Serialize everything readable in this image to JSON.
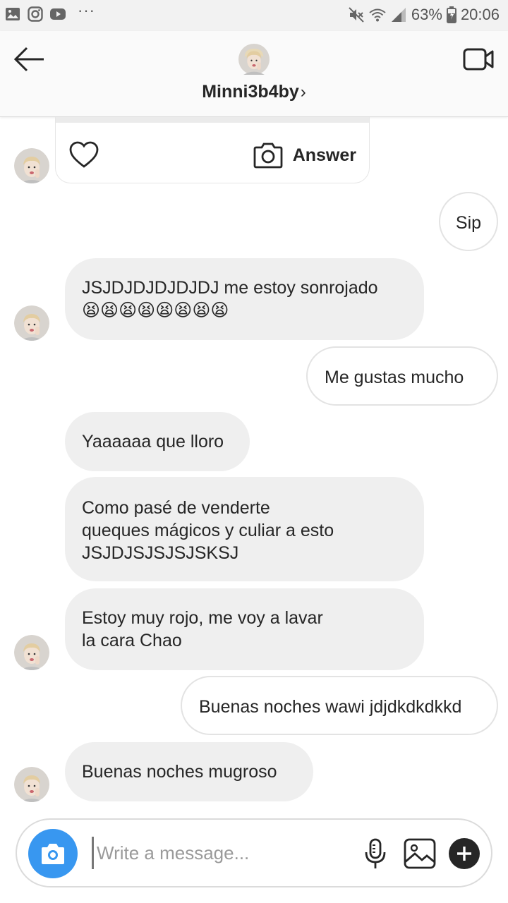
{
  "status_bar": {
    "dots": "···",
    "battery": "63%",
    "time": "20:06",
    "icons": [
      "gallery-icon",
      "instagram-icon",
      "youtube-icon",
      "mute-icon",
      "wifi-icon",
      "signal-icon",
      "battery-icon"
    ]
  },
  "header": {
    "username": "Minni3b4by",
    "chevron": "›",
    "icons": [
      "back-arrow-icon",
      "video-call-icon"
    ]
  },
  "story_reply": {
    "answer_label": "Answer",
    "icons": [
      "heart-icon",
      "camera-outline-icon"
    ]
  },
  "messages": [
    {
      "from": "me",
      "text": "Sip"
    },
    {
      "from": "them",
      "text": "JSJDJDJDJDJDJ me estoy sonrojado\n😫😫😫😫😫😫😫😫"
    },
    {
      "from": "me",
      "text": "Me gustas mucho"
    },
    {
      "from": "them",
      "text": "Yaaaaaa que lloro"
    },
    {
      "from": "them",
      "text": "Como pasé de venderte\nqueques mágicos y culiar a esto\nJSJDJSJSJSJSKSJ"
    },
    {
      "from": "them",
      "text": "Estoy muy rojo, me voy a lavar\nla cara Chao"
    },
    {
      "from": "me",
      "text": "Buenas noches wawi jdjdkdkdkkd"
    },
    {
      "from": "them",
      "text": "Buenas noches mugroso"
    }
  ],
  "composer": {
    "placeholder": "Write a message...",
    "value": "",
    "icons": [
      "camera-icon",
      "microphone-icon",
      "gallery-icon",
      "plus-icon"
    ]
  },
  "colors": {
    "accent_blue": "#3897f0",
    "incoming_bubble": "#efefef",
    "outgoing_border": "#e3e3e3",
    "header_bg": "#fafafa",
    "status_bar_bg": "#f2f2f2"
  }
}
